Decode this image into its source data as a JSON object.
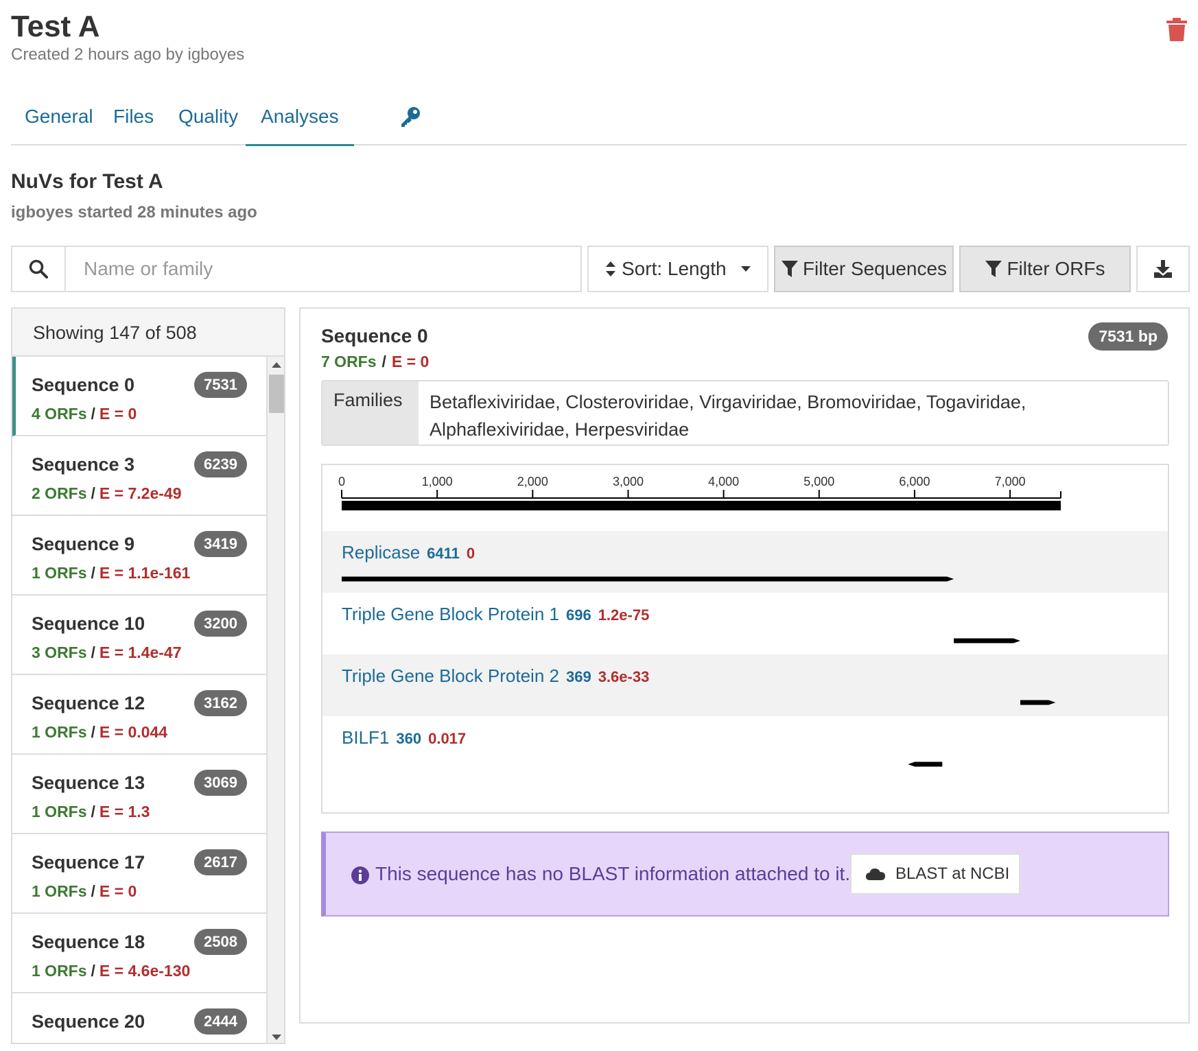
{
  "header": {
    "title": "Test A",
    "subtitle": "Created 2 hours ago by igboyes"
  },
  "tabs": [
    {
      "label": "General"
    },
    {
      "label": "Files"
    },
    {
      "label": "Quality"
    },
    {
      "label": "Analyses"
    }
  ],
  "section": {
    "title": "NuVs for Test A",
    "subtitle": "igboyes started 28 minutes ago"
  },
  "toolbar": {
    "search_placeholder": "Name or family",
    "sort_label": "Sort: Length",
    "filter_sequences_label": "Filter Sequences",
    "filter_orfs_label": "Filter ORFs"
  },
  "list": {
    "header": "Showing 147 of 508",
    "items": [
      {
        "name": "Sequence 0",
        "length": "7531",
        "orfs": "4 ORFs",
        "e": "E = 0"
      },
      {
        "name": "Sequence 3",
        "length": "6239",
        "orfs": "2 ORFs",
        "e": "E = 7.2e-49"
      },
      {
        "name": "Sequence 9",
        "length": "3419",
        "orfs": "1 ORFs",
        "e": "E = 1.1e-161"
      },
      {
        "name": "Sequence 10",
        "length": "3200",
        "orfs": "3 ORFs",
        "e": "E = 1.4e-47"
      },
      {
        "name": "Sequence 12",
        "length": "3162",
        "orfs": "1 ORFs",
        "e": "E = 0.044"
      },
      {
        "name": "Sequence 13",
        "length": "3069",
        "orfs": "1 ORFs",
        "e": "E = 1.3"
      },
      {
        "name": "Sequence 17",
        "length": "2617",
        "orfs": "1 ORFs",
        "e": "E = 0"
      },
      {
        "name": "Sequence 18",
        "length": "2508",
        "orfs": "1 ORFs",
        "e": "E = 4.6e-130"
      },
      {
        "name": "Sequence 20",
        "length": "2444",
        "orfs": "",
        "e": ""
      }
    ]
  },
  "detail": {
    "title": "Sequence 0",
    "orfs": "7 ORFs",
    "separator": "/",
    "e": "E = 0",
    "length_badge": "7531 bp",
    "families_label": "Families",
    "families_value": "Betaflexiviridae, Closteroviridae, Virgaviridae, Bromoviridae, Togaviridae, Alphaflexiviridae, Herpesviridae",
    "sequence_length": 7531,
    "axis_ticks": [
      "0",
      "1,000",
      "2,000",
      "3,000",
      "4,000",
      "5,000",
      "6,000",
      "7,000"
    ],
    "orfs_list": [
      {
        "name": "Replicase",
        "length": "6411",
        "e": "0",
        "start": 0,
        "end": 6411,
        "strand": "+"
      },
      {
        "name": "Triple Gene Block Protein 1",
        "length": "696",
        "e": "1.2e-75",
        "start": 6411,
        "end": 7107,
        "strand": "+"
      },
      {
        "name": "Triple Gene Block Protein 2",
        "length": "369",
        "e": "3.6e-33",
        "start": 7107,
        "end": 7476,
        "strand": "+"
      },
      {
        "name": "BILF1",
        "length": "360",
        "e": "0.017",
        "start": 5930,
        "end": 6290,
        "strand": "-"
      }
    ],
    "alert_text": "This sequence has no BLAST information attached to it.",
    "blast_label": "BLAST at NCBI"
  },
  "colors": {
    "link_blue": "#1b6b99",
    "green": "#3d7a33",
    "red": "#b22d2d",
    "badge_gray": "#6b6b6b",
    "trash_red": "#d9534f",
    "alert_purple": "#5a3d99"
  }
}
